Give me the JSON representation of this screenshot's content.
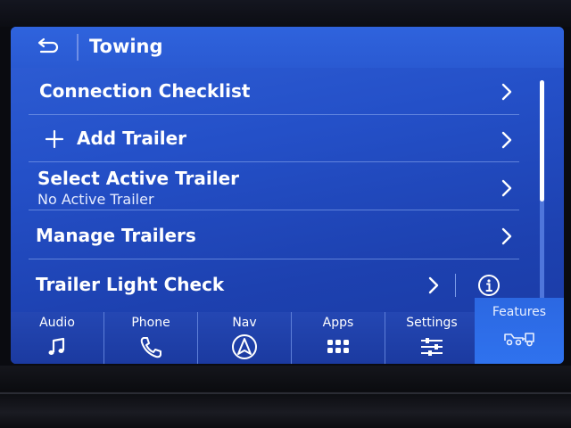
{
  "header": {
    "title": "Towing",
    "back_icon": "back-arrow-icon"
  },
  "rows": [
    {
      "label": "Connection Checklist",
      "icon": "chevron-right-icon"
    },
    {
      "label": "Add Trailer",
      "icon": "plus-icon"
    },
    {
      "label": "Select Active Trailer",
      "sublabel": "No Active Trailer"
    },
    {
      "label": "Manage Trailers"
    },
    {
      "label": "Trailer Light Check",
      "extra_icon": "info-icon"
    }
  ],
  "nav": [
    {
      "label": "Audio",
      "icon": "music-note-icon"
    },
    {
      "label": "Phone",
      "icon": "phone-icon"
    },
    {
      "label": "Nav",
      "icon": "navigation-arrow-icon"
    },
    {
      "label": "Apps",
      "icon": "apps-grid-icon"
    },
    {
      "label": "Settings",
      "icon": "settings-sliders-icon"
    },
    {
      "label": "Features",
      "icon": "truck-trailer-icon",
      "active": true
    }
  ],
  "colors": {
    "screen": "#2450c8",
    "header": "#2c5cd6",
    "active_tab": "#2f6fe8",
    "text": "#ffffff"
  }
}
